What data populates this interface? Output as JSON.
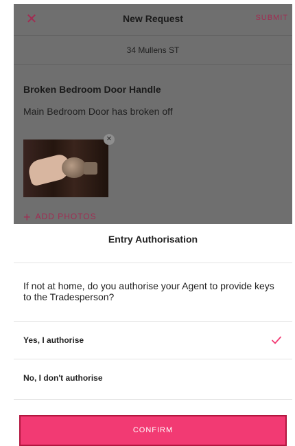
{
  "request_screen": {
    "title": "New Request",
    "submit_label": "SUBMIT",
    "address": "34 Mullens ST",
    "issue_title": "Broken Bedroom Door Handle",
    "issue_description": "Main Bedroom Door has broken off",
    "add_photos_label": "ADD PHOTOS"
  },
  "entry_sheet": {
    "title": "Entry Authorisation",
    "question": "If not at home, do you authorise your Agent to provide keys to the Tradesperson?",
    "options": [
      {
        "label": "Yes, I authorise",
        "selected": true
      },
      {
        "label": "No, I don't authorise",
        "selected": false
      }
    ],
    "confirm_label": "CONFIRM"
  },
  "colors": {
    "accent": "#f23a73",
    "accent_dim": "#a12c52",
    "overlay": "#6f6f6f"
  },
  "icons": {
    "close": "close-icon",
    "remove_photo": "remove-photo-icon",
    "add": "plus-icon",
    "selected": "checkmark-icon"
  }
}
